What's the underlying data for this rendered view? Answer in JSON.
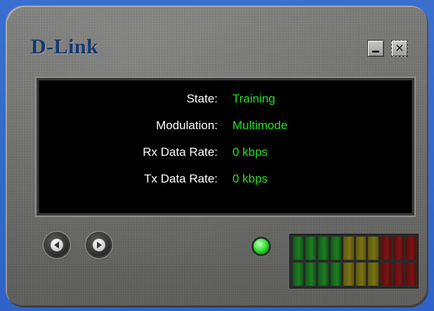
{
  "window": {
    "brand": "D-Link",
    "controls": {
      "minimize_glyph": "",
      "close_glyph": "✕"
    }
  },
  "status": {
    "state": {
      "label": "State:",
      "value": "Training"
    },
    "modulation": {
      "label": "Modulation:",
      "value": "Multimode"
    },
    "rx_rate": {
      "label": "Rx Data Rate:",
      "value": "0 kbps"
    },
    "tx_rate": {
      "label": "Tx Data Rate:",
      "value": "0 kbps"
    }
  },
  "indicators": {
    "link_led_color": "#39e63a",
    "meter": {
      "segments_per_row": 10,
      "segment_colors": [
        "green",
        "green",
        "green",
        "green",
        "yellow",
        "yellow",
        "yellow",
        "red",
        "red",
        "red"
      ],
      "level": 0
    }
  },
  "colors": {
    "brand": "#13386e",
    "value_text": "#22e024",
    "label_text": "#ffffff",
    "screen_bg": "#000000"
  }
}
